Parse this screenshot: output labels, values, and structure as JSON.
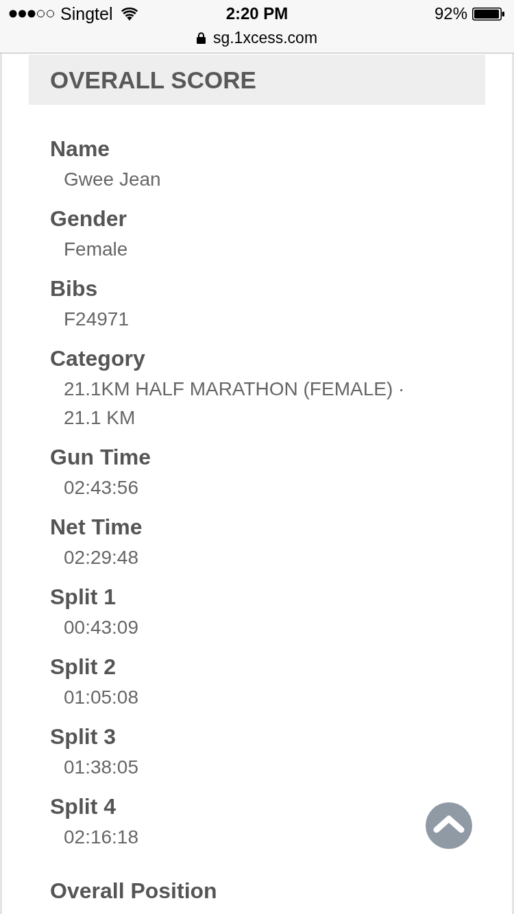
{
  "status_bar": {
    "carrier": "Singtel",
    "time": "2:20 PM",
    "battery": "92%"
  },
  "address_bar": {
    "url": "sg.1xcess.com"
  },
  "section": {
    "title": "OVERALL SCORE"
  },
  "fields": [
    {
      "label": "Name",
      "value": "Gwee Jean"
    },
    {
      "label": "Gender",
      "value": "Female"
    },
    {
      "label": "Bibs",
      "value": "F24971"
    },
    {
      "label": "Category",
      "value": "21.1KM HALF MARATHON (FEMALE) · 21.1 KM"
    },
    {
      "label": "Gun Time",
      "value": "02:43:56"
    },
    {
      "label": "Net Time",
      "value": "02:29:48"
    },
    {
      "label": "Split 1",
      "value": "00:43:09"
    },
    {
      "label": "Split 2",
      "value": "01:05:08"
    },
    {
      "label": "Split 3",
      "value": "01:38:05"
    },
    {
      "label": "Split 4",
      "value": "02:16:18"
    }
  ],
  "next_field": {
    "label": "Overall Position"
  }
}
